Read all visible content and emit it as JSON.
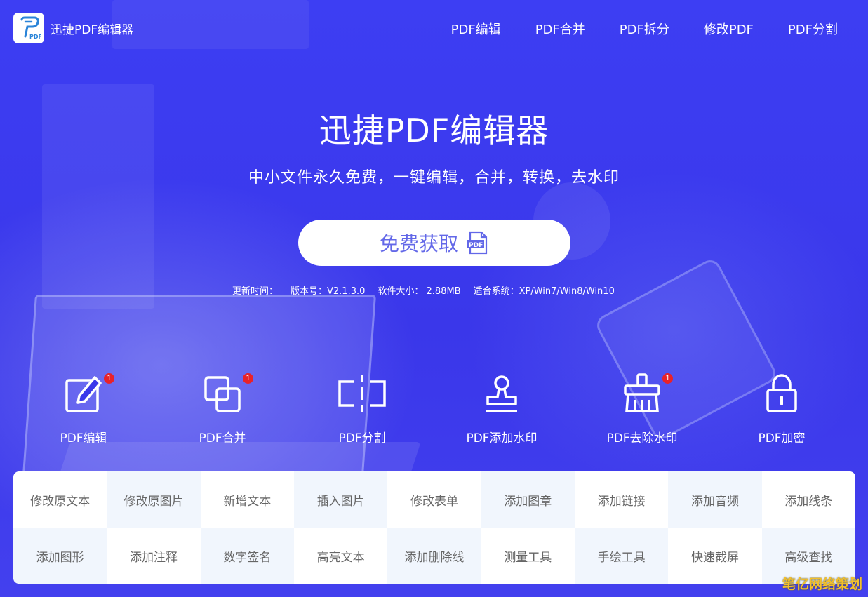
{
  "header": {
    "logo_badge": "PDF",
    "logo_text": "迅捷PDF编辑器",
    "nav": [
      "PDF编辑",
      "PDF合并",
      "PDF拆分",
      "修改PDF",
      "PDF分割"
    ]
  },
  "hero": {
    "title": "迅捷PDF编辑器",
    "subtitle": "中小文件永久免费，一键编辑，合并，转换，去水印",
    "cta_label": "免费获取",
    "cta_icon_text": "PDF"
  },
  "meta": {
    "update_time": "更新时间：",
    "version": "版本号：V2.1.3.0",
    "size": "软件大小： 2.88MB",
    "system": "适合系统：XP/Win7/Win8/Win10"
  },
  "features": [
    {
      "label": "PDF编辑",
      "icon": "edit-icon",
      "badge": "1"
    },
    {
      "label": "PDF合并",
      "icon": "merge-icon",
      "badge": "1"
    },
    {
      "label": "PDF分割",
      "icon": "split-icon",
      "badge": ""
    },
    {
      "label": "PDF添加水印",
      "icon": "stamp-icon",
      "badge": ""
    },
    {
      "label": "PDF去除水印",
      "icon": "brush-icon",
      "badge": "1"
    },
    {
      "label": "PDF加密",
      "icon": "lock-icon",
      "badge": ""
    }
  ],
  "grid": [
    "修改原文本",
    "修改原图片",
    "新增文本",
    "插入图片",
    "修改表单",
    "添加图章",
    "添加链接",
    "添加音频",
    "添加线条",
    "添加图形",
    "添加注释",
    "数字签名",
    "高亮文本",
    "添加删除线",
    "测量工具",
    "手绘工具",
    "快速截屏",
    "高级查找"
  ],
  "watermark": "笔亿网络策划",
  "colors": {
    "background": "#3a36e6",
    "accent": "#6368e8",
    "badge": "#e8222a"
  }
}
